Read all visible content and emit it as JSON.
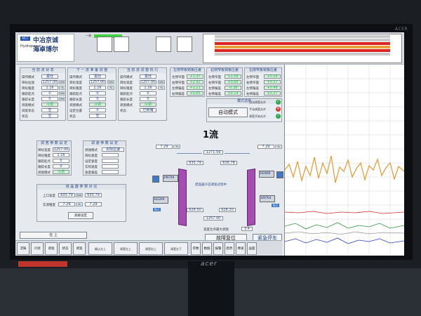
{
  "bezel_tag": "ACER",
  "company": {
    "line1": "中冶京诚",
    "line2": "海卓博尔",
    "small": "MCC",
    "sub": "Hydropower"
  },
  "header": {
    "top_label": "一流"
  },
  "flow_title": "1流",
  "panels": {
    "p1": {
      "title": "当 前 流 状 态",
      "rows": [
        {
          "label": "操作模式",
          "value": "拔坯"
        },
        {
          "label": "目标拉速",
          "value": "1257.00",
          "unit": "mm"
        },
        {
          "label": "目标锥度",
          "value": "1.16",
          "unit": "%"
        },
        {
          "label": "跟踪起点",
          "value": "0",
          "unit": "mm"
        },
        {
          "label": "跟踪长度",
          "value": "0",
          "unit": "mm"
        },
        {
          "label": "调宽模式",
          "value": "冷调"
        },
        {
          "label": "调宽状态",
          "value": "空"
        },
        {
          "label": "状态",
          "value": "空"
        }
      ]
    },
    "p2": {
      "title": "下 一 流 准 备 调 整",
      "rows": [
        {
          "label": "操作模式",
          "value": "拔坯"
        },
        {
          "label": "目标宽度",
          "value": "1257.00",
          "unit": "mm"
        },
        {
          "label": "目标锥度",
          "value": "1.16",
          "unit": "%"
        },
        {
          "label": "跟踪起点",
          "value": "0",
          "unit": "mm"
        },
        {
          "label": "跟踪长度",
          "value": "0",
          "unit": "mm"
        },
        {
          "label": "调宽模式",
          "value": "冷调"
        },
        {
          "label": "设定位置",
          "value": "0",
          "unit": "mm"
        },
        {
          "label": "状态",
          "value": "空"
        }
      ]
    },
    "p3": {
      "title": "当 前 流 调 整 执 行",
      "rows": [
        {
          "label": "操作模式",
          "value": "拔坯"
        },
        {
          "label": "目标宽度",
          "value": "1257.00",
          "unit": "mm"
        },
        {
          "label": "目标锥度",
          "value": "1.16",
          "unit": "%"
        },
        {
          "label": "跟踪起点",
          "value": "0",
          "unit": "mm"
        },
        {
          "label": "跟踪长度",
          "value": "0",
          "unit": "mm"
        },
        {
          "label": "调宽模式",
          "value": "冷调"
        },
        {
          "label": "状态",
          "value": "已就绪"
        }
      ]
    },
    "p4": {
      "title": "左侧窄板铜板压差",
      "rows": [
        {
          "label": "左侧窄面",
          "value": "+1.37"
        },
        {
          "label": "右侧窄面",
          "value": "+2.42"
        },
        {
          "label": "左侧偏差",
          "value": "+1.11"
        },
        {
          "label": "右侧偏差",
          "value": "+0.65"
        }
      ]
    },
    "p5": {
      "title": "右侧窄板铜板压差",
      "rows": [
        {
          "label": "左侧窄面",
          "value": "+1.58"
        },
        {
          "label": "右侧窄面",
          "value": "+0.66"
        },
        {
          "label": "左侧偏差",
          "value": "-0.38"
        },
        {
          "label": "右侧偏差",
          "value": "+0.14"
        }
      ]
    },
    "p6": {
      "title": "右侧窄板铜板压差",
      "rows": [
        {
          "label": "左侧窄面",
          "value": "+0.58"
        },
        {
          "label": "右侧窄面",
          "value": "+0.37"
        },
        {
          "label": "左侧偏差",
          "value": "+0.48"
        },
        {
          "label": "右侧偏差",
          "value": "+0.27"
        }
      ]
    },
    "p7": {
      "title": "调 宽 参 数 设 定",
      "rows": [
        {
          "label": "目标宽度",
          "value": "1257.00",
          "unit": "mm"
        },
        {
          "label": "目标锥度",
          "value": "1.16",
          "unit": "%"
        },
        {
          "label": "跟踪起点",
          "value": "0",
          "unit": "mm"
        },
        {
          "label": "跟踪长度",
          "value": "0",
          "unit": "mm"
        },
        {
          "label": "调宽模式",
          "value": "冷调"
        }
      ]
    },
    "p8": {
      "title": "调 速 参 数 设 定",
      "rows": [
        {
          "label": "调速模式",
          "value": "实际拉速"
        },
        {
          "label": "目标速度",
          "value": ""
        },
        {
          "label": "设定速度",
          "value": ""
        },
        {
          "label": "实际速度",
          "value": ""
        },
        {
          "label": "速度偏差",
          "value": ""
        }
      ]
    },
    "p9": {
      "title": "结 晶 器 参 数 对 比",
      "rows": [
        {
          "label": "上口宽度",
          "value": "635.79",
          "unit": "mm",
          "value2": "635.79"
        },
        {
          "label": "实测锥度",
          "value": "7.29",
          "unit": "%",
          "value2": "7.29"
        }
      ],
      "button": "高级设定"
    }
  },
  "status_right": {
    "title": "模式选择",
    "mode_button": "自动模式",
    "items": [
      {
        "label": "自动调宽允许",
        "state": "ok"
      },
      {
        "label": "手动调宽允许",
        "state": "x"
      },
      {
        "label": "调宽开始允许",
        "state": "ok"
      }
    ]
  },
  "diagram": {
    "center_label": "结晶器冷态调宽过程中",
    "top_left_val": "7.29",
    "top_right_val": "7.29",
    "top_mid_val": "1271.59",
    "left_mid_val": "635.79",
    "right_mid_val": "636.78",
    "left_block": "296749",
    "right_block": "302690",
    "left_low_block": "302269",
    "right_low_block": "309764",
    "bottom_left_val": "628.50",
    "bottom_right_val": "628.20",
    "bottom_mid_val": "1257.00",
    "left_tag": "N-2",
    "right_tag": "N-2",
    "unit_mm": "mm",
    "unit_pct": "%"
  },
  "bottom_center": {
    "speed_label": "宽度允许最大调宽",
    "speed_val": "3.4",
    "reset": "故障复位",
    "stop": "紧急停车"
  },
  "bottom_bar": {
    "buttons": [
      "浇铸",
      "冷调",
      "调宽",
      "状态",
      "调宽",
      "参数",
      "数据",
      "报警",
      "趋势",
      "棒速",
      "画面"
    ],
    "pairs": [
      "确认左上",
      "调宽左上",
      "调宽右上",
      "调宽左下",
      "调宽右下"
    ],
    "left_label": "在 上"
  },
  "trend": {
    "top_series_color": "#e39a2b",
    "bottom_series_colors": [
      "#d12a2a",
      "#2e9a3a",
      "#2d3ed1",
      "#7a7a7a"
    ]
  }
}
